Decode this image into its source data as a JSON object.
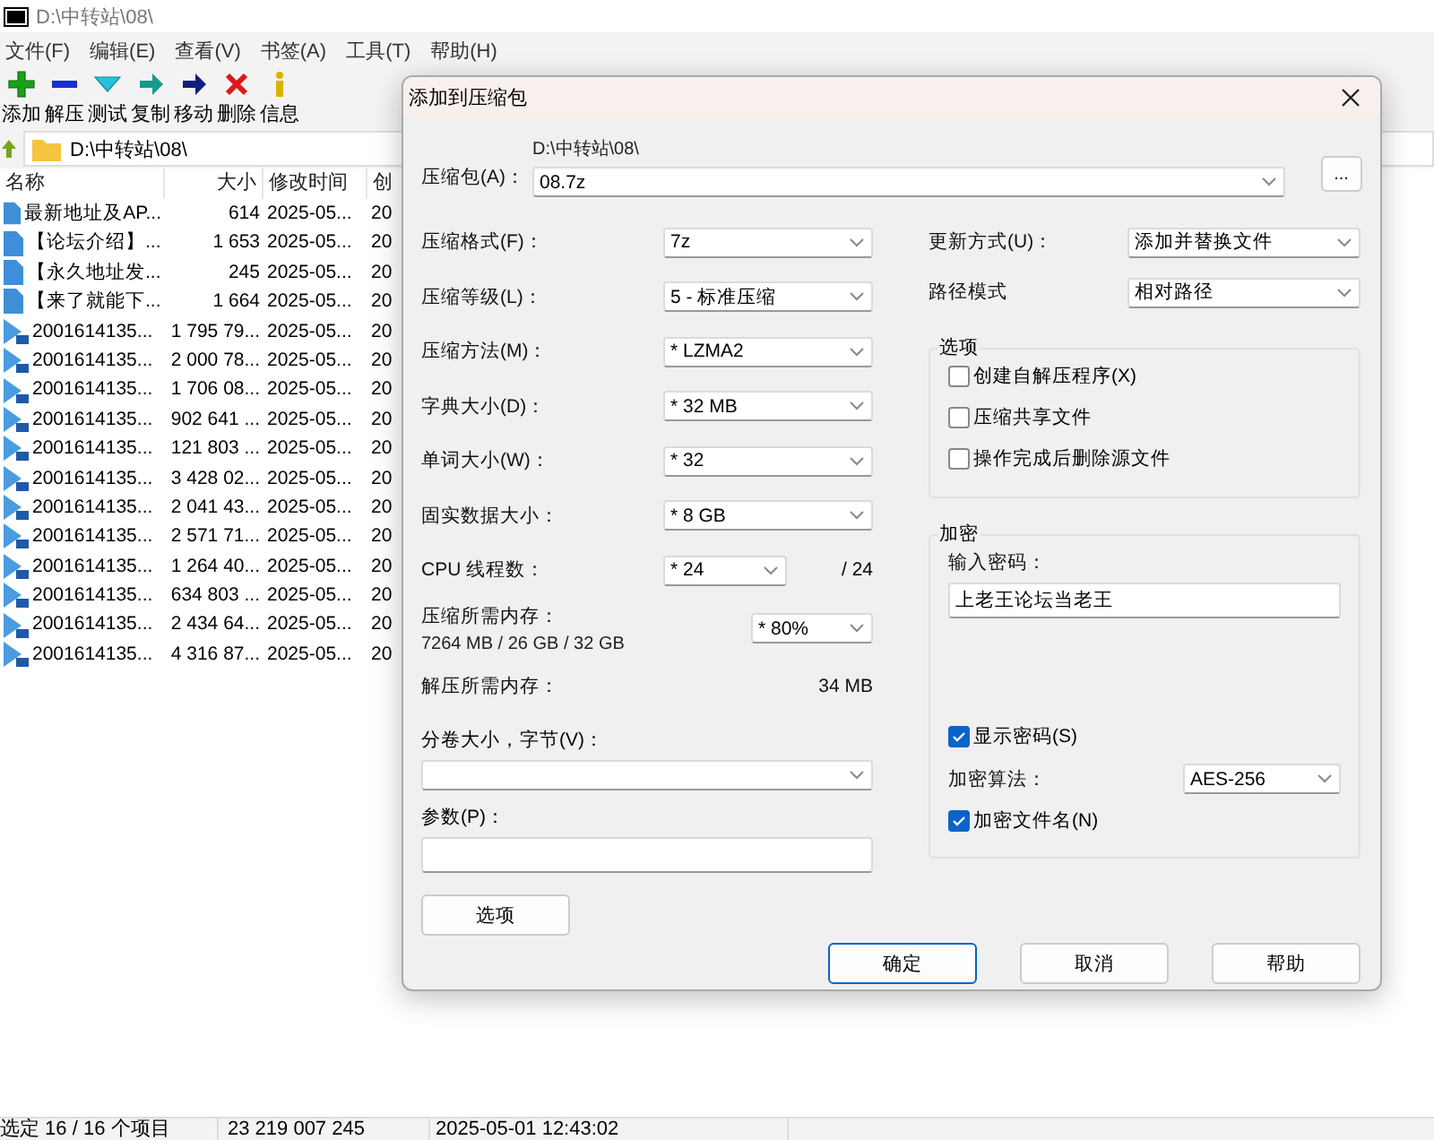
{
  "window": {
    "title": "D:\\中转站\\08\\"
  },
  "menu": [
    "文件(F)",
    "编辑(E)",
    "查看(V)",
    "书签(A)",
    "工具(T)",
    "帮助(H)"
  ],
  "toolbar": [
    {
      "label": "添加",
      "kind": "add"
    },
    {
      "label": "解压",
      "kind": "extract"
    },
    {
      "label": "测试",
      "kind": "test"
    },
    {
      "label": "复制",
      "kind": "copy"
    },
    {
      "label": "移动",
      "kind": "move"
    },
    {
      "label": "删除",
      "kind": "delete"
    },
    {
      "label": "信息",
      "kind": "info"
    }
  ],
  "address": "D:\\中转站\\08\\",
  "table": {
    "columns": [
      "名称",
      "大小",
      "修改时间",
      "创"
    ],
    "rows": [
      {
        "kind": "doc",
        "name": "最新地址及AP...",
        "size": "614",
        "modified": "2025-05...",
        "column_4": "20"
      },
      {
        "kind": "doc",
        "name": "【论坛介绍】...",
        "size": "1 653",
        "modified": "2025-05...",
        "column_4": "20"
      },
      {
        "kind": "doc",
        "name": "【永久地址发...",
        "size": "245",
        "modified": "2025-05...",
        "column_4": "20"
      },
      {
        "kind": "doc",
        "name": "【来了就能下...",
        "size": "1 664",
        "modified": "2025-05...",
        "column_4": "20"
      },
      {
        "kind": "video",
        "name": "2001614135...",
        "size": "1 795 79...",
        "modified": "2025-05...",
        "column_4": "20"
      },
      {
        "kind": "video",
        "name": "2001614135...",
        "size": "2 000 78...",
        "modified": "2025-05...",
        "column_4": "20"
      },
      {
        "kind": "video",
        "name": "2001614135...",
        "size": "1 706 08...",
        "modified": "2025-05...",
        "column_4": "20"
      },
      {
        "kind": "video",
        "name": "2001614135...",
        "size": "902 641 ...",
        "modified": "2025-05...",
        "column_4": "20"
      },
      {
        "kind": "video",
        "name": "2001614135...",
        "size": "121 803 ...",
        "modified": "2025-05...",
        "column_4": "20"
      },
      {
        "kind": "video",
        "name": "2001614135...",
        "size": "3 428 02...",
        "modified": "2025-05...",
        "column_4": "20"
      },
      {
        "kind": "video",
        "name": "2001614135...",
        "size": "2 041 43...",
        "modified": "2025-05...",
        "column_4": "20"
      },
      {
        "kind": "video",
        "name": "2001614135...",
        "size": "2 571 71...",
        "modified": "2025-05...",
        "column_4": "20"
      },
      {
        "kind": "video",
        "name": "2001614135...",
        "size": "1 264 40...",
        "modified": "2025-05...",
        "column_4": "20"
      },
      {
        "kind": "video",
        "name": "2001614135...",
        "size": "634 803 ...",
        "modified": "2025-05...",
        "column_4": "20"
      },
      {
        "kind": "video",
        "name": "2001614135...",
        "size": "2 434 64...",
        "modified": "2025-05...",
        "column_4": "20"
      },
      {
        "kind": "video",
        "name": "2001614135...",
        "size": "4 316 87...",
        "modified": "2025-05...",
        "column_4": "20"
      }
    ]
  },
  "status_bar": [
    "选定 16 / 16 个项目",
    "23 219 007 245",
    "2025-05-01 12:43:02"
  ],
  "dialog": {
    "title": "添加到压缩包",
    "archive": {
      "label": "压缩包(A)：",
      "path": "D:\\中转站\\08\\",
      "value": "08.7z",
      "browse": "..."
    },
    "settings": [
      {
        "kind": "select",
        "label": "压缩格式(F)：",
        "value": "7z"
      },
      {
        "kind": "select",
        "label": "压缩等级(L)：",
        "value": "5 - 标准压缩"
      },
      {
        "kind": "select",
        "label": "压缩方法(M)：",
        "value": "* LZMA2"
      },
      {
        "kind": "select",
        "label": "字典大小(D)：",
        "value": "* 32 MB"
      },
      {
        "kind": "select",
        "label": "单词大小(W)：",
        "value": "* 32"
      },
      {
        "kind": "select",
        "label": "固实数据大小：",
        "value": "* 8 GB"
      },
      {
        "kind": "select_note",
        "label": "CPU 线程数：",
        "value": "* 24",
        "note": "/ 24"
      },
      {
        "kind": "memory",
        "label": "压缩所需内存：",
        "detail": "7264 MB / 26 GB / 32 GB",
        "value": "* 80%"
      },
      {
        "kind": "text",
        "label": "解压所需内存：",
        "value": "34 MB"
      }
    ],
    "split": {
      "label": "分卷大小，字节(V)："
    },
    "params": {
      "label": "参数(P)："
    },
    "options_button": "选项",
    "update": {
      "label": "更新方式(U)：",
      "value": "添加并替换文件"
    },
    "path_mode": {
      "label": "路径模式",
      "value": "相对路径"
    },
    "options": {
      "title": "选项",
      "items": [
        {
          "label": "创建自解压程序(X)",
          "checked": false
        },
        {
          "label": "压缩共享文件",
          "checked": false
        },
        {
          "label": "操作完成后删除源文件",
          "checked": false
        }
      ]
    },
    "encryption": {
      "title": "加密",
      "password_label": "输入密码：",
      "password": "上老王论坛当老王",
      "show_password": {
        "label": "显示密码(S)",
        "checked": true
      },
      "method_label": "加密算法：",
      "method": "AES-256",
      "encrypt_names": {
        "label": "加密文件名(N)",
        "checked": true
      }
    },
    "buttons": [
      {
        "label": "确定",
        "default": true
      },
      {
        "label": "取消",
        "default": false
      },
      {
        "label": "帮助",
        "default": false
      }
    ]
  }
}
